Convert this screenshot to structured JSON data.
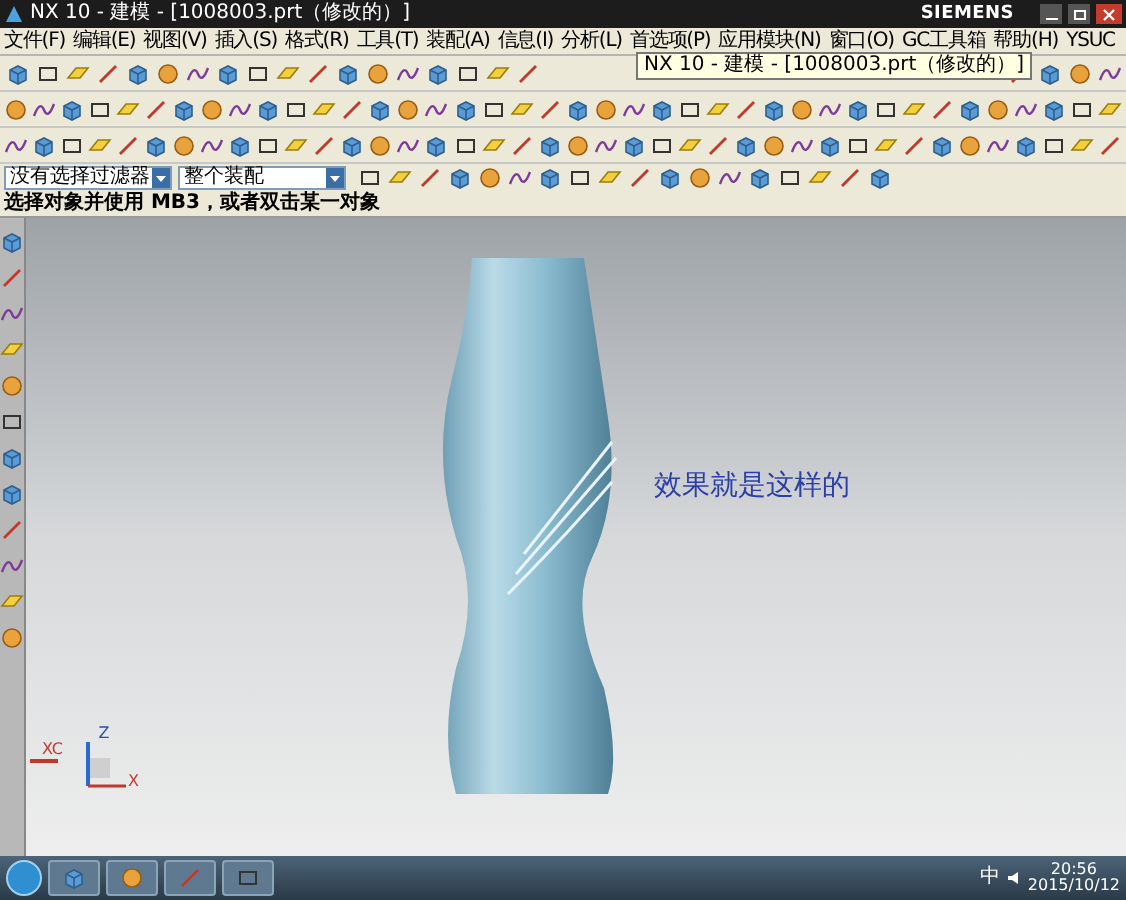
{
  "window": {
    "title": "NX 10 - 建模 - [1008003.prt（修改的）]",
    "brand": "SIEMENS"
  },
  "tooltip": "NX 10 - 建模 - [1008003.prt（修改的）]",
  "menu": [
    "文件(F)",
    "编辑(E)",
    "视图(V)",
    "插入(S)",
    "格式(R)",
    "工具(T)",
    "装配(A)",
    "信息(I)",
    "分析(L)",
    "首选项(P)",
    "应用模块(N)",
    "窗口(O)",
    "GC工具箱",
    "帮助(H)",
    "YSUC"
  ],
  "filters": [
    {
      "value": "没有选择过滤器"
    },
    {
      "value": "整个装配"
    }
  ],
  "cue_line": "选择对象并使用 MB3，或者双击某一对象",
  "viewport": {
    "annotation": "效果就是这样的",
    "wcs_label": "XC",
    "triad": {
      "z": "Z",
      "x": "X"
    }
  },
  "taskbar": {
    "input_method": "中",
    "time": "20:56",
    "date": "2015/10/12"
  }
}
